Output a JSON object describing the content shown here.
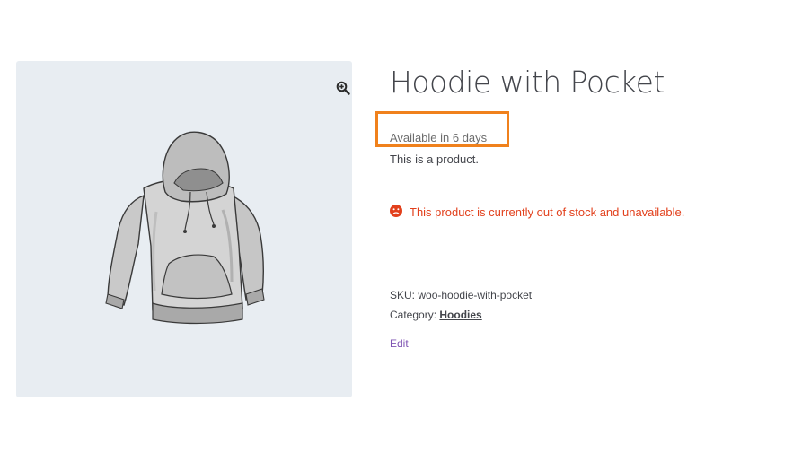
{
  "product": {
    "title": "Hoodie with Pocket",
    "availability": "Available in 6 days",
    "short_description": "This is a product.",
    "stock_notice": "This product is currently out of stock and unavailable.",
    "sku_label": "SKU:",
    "sku_value": "woo-hoodie-with-pocket",
    "category_label": "Category:",
    "category_value": "Hoodies",
    "edit_label": "Edit"
  },
  "gallery": {
    "zoom_icon": "zoom-in-icon",
    "image_subject": "hoodie-image"
  },
  "colors": {
    "highlight": "#f0811c",
    "error": "#e2401c",
    "link": "#7f54b3",
    "gallery_bg": "#e8edf2"
  }
}
